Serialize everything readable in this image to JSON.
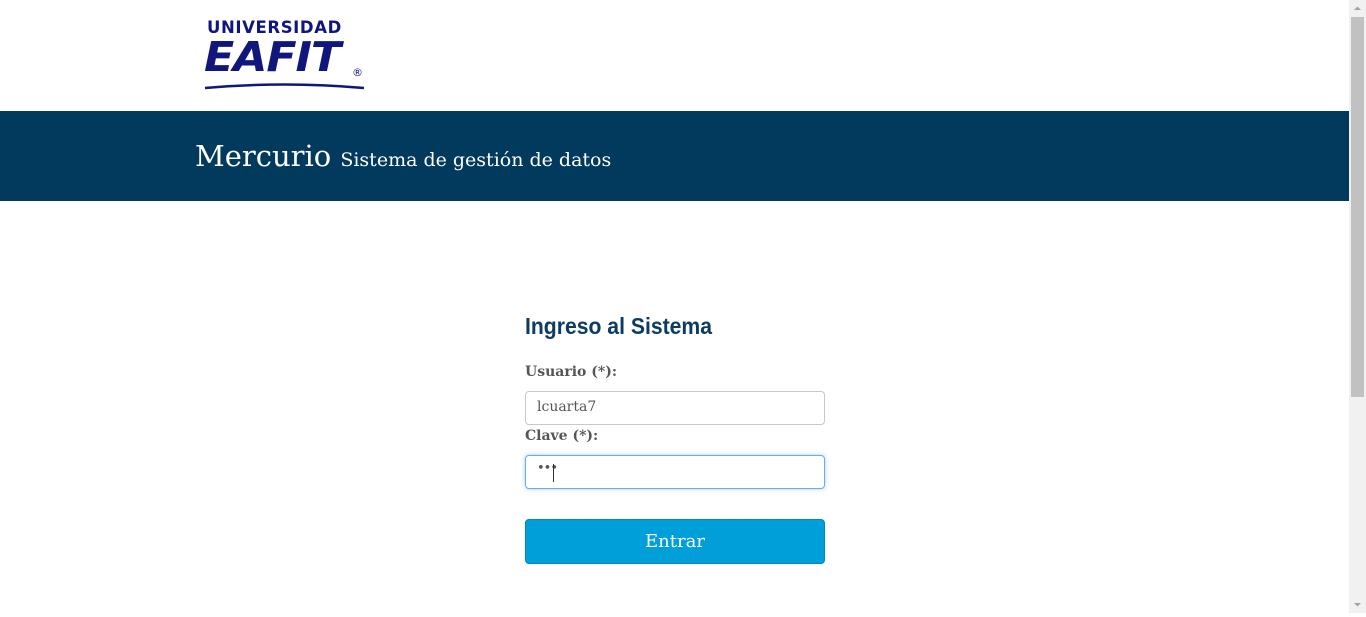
{
  "logo": {
    "line1": "UNIVERSIDAD",
    "line2": "EAFIT",
    "registered": "®",
    "color": "#11167c"
  },
  "banner": {
    "app_name": "Mercurio",
    "subtitle": "Sistema de gestión de datos",
    "background": "#013a5c"
  },
  "login": {
    "title": "Ingreso al Sistema",
    "username": {
      "label": "Usuario (*):",
      "value": "lcuarta7"
    },
    "password": {
      "label": "Clave (*):",
      "masked_value": "•••"
    },
    "submit_label": "Entrar",
    "accent": "#009fd9"
  },
  "icons": {
    "scroll_up": "chevron-up-icon",
    "scroll_down": "chevron-down-icon"
  }
}
